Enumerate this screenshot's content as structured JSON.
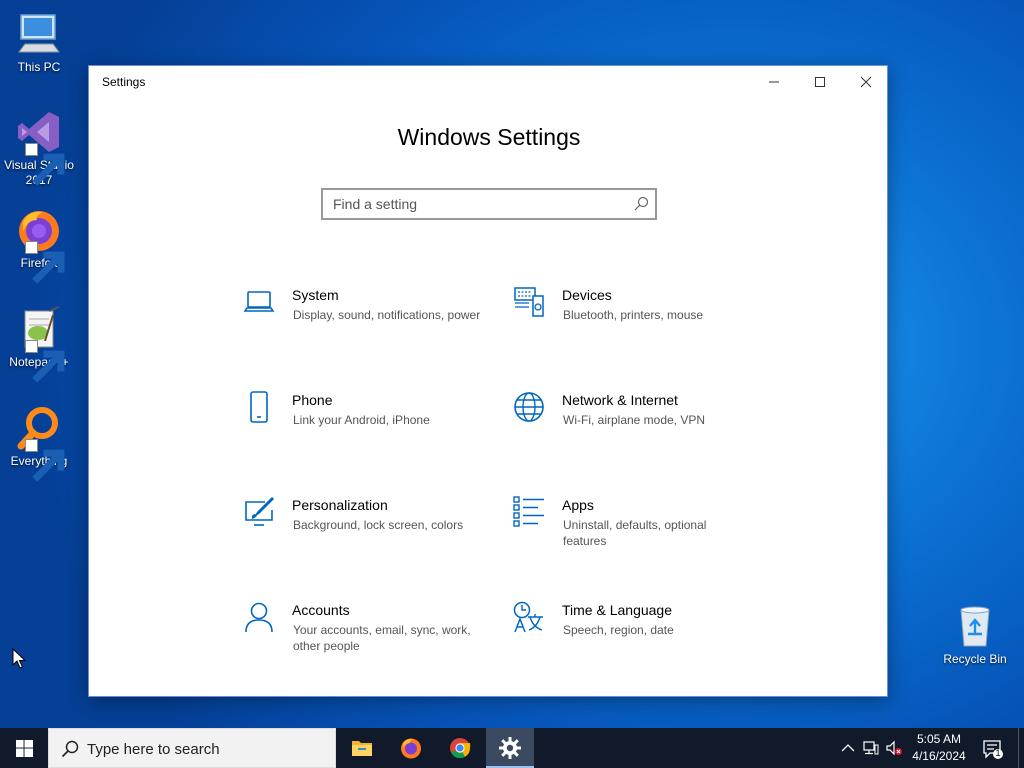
{
  "desktop": {
    "icons": [
      {
        "label": "This PC"
      },
      {
        "label": "Visual Studio 2017"
      },
      {
        "label": "Firefox"
      },
      {
        "label": "Notepad++"
      },
      {
        "label": "Everything"
      },
      {
        "label": "Recycle Bin"
      }
    ]
  },
  "window": {
    "title": "Settings",
    "heading": "Windows Settings",
    "search_placeholder": "Find a setting",
    "tiles": [
      {
        "name": "System",
        "desc": "Display, sound, notifications, power",
        "icon": "laptop-icon"
      },
      {
        "name": "Devices",
        "desc": "Bluetooth, printers, mouse",
        "icon": "devices-icon"
      },
      {
        "name": "Phone",
        "desc": "Link your Android, iPhone",
        "icon": "phone-icon"
      },
      {
        "name": "Network & Internet",
        "desc": "Wi-Fi, airplane mode, VPN",
        "icon": "globe-icon"
      },
      {
        "name": "Personalization",
        "desc": "Background, lock screen, colors",
        "icon": "paint-icon"
      },
      {
        "name": "Apps",
        "desc": "Uninstall, defaults, optional features",
        "icon": "apps-list-icon"
      },
      {
        "name": "Accounts",
        "desc": "Your accounts, email, sync, work, other people",
        "icon": "person-icon"
      },
      {
        "name": "Time & Language",
        "desc": "Speech, region, date",
        "icon": "time-language-icon"
      }
    ]
  },
  "taskbar": {
    "search_placeholder": "Type here to search",
    "time": "5:05 AM",
    "date": "4/16/2024",
    "notification_count": "1"
  },
  "colors": {
    "accent": "#0067c0",
    "taskbar": "#101a2b"
  }
}
